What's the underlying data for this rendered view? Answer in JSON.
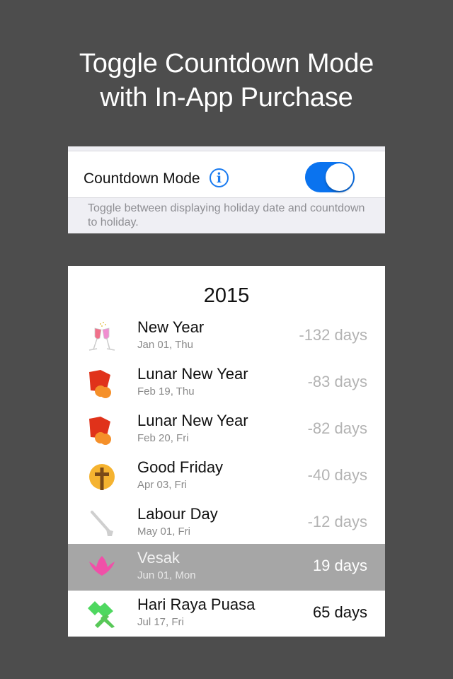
{
  "headline": {
    "line1": "Toggle Countdown Mode",
    "line2": "with In-App Purchase"
  },
  "settings": {
    "countdown_mode_label": "Countdown Mode",
    "info_icon": "info-circle-icon",
    "toggle_on": true,
    "toggle_color": "#0a73ef",
    "footer_text": "Toggle between displaying holiday date and countdown to holiday."
  },
  "holidays": {
    "year": "2015",
    "items": [
      {
        "name": "New Year",
        "date": "Jan 01, Thu",
        "count": "-132 days",
        "icon": "champagne-glasses-icon"
      },
      {
        "name": "Lunar New Year",
        "date": "Feb 19, Thu",
        "count": "-83 days",
        "icon": "red-packet-icon"
      },
      {
        "name": "Lunar New Year",
        "date": "Feb 20, Fri",
        "count": "-82 days",
        "icon": "red-packet-icon"
      },
      {
        "name": "Good Friday",
        "date": "Apr 03, Fri",
        "count": "-40 days",
        "icon": "cross-icon"
      },
      {
        "name": "Labour Day",
        "date": "May 01, Fri",
        "count": "-12 days",
        "icon": "wrench-icon"
      },
      {
        "name": "Vesak",
        "date": "Jun 01, Mon",
        "count": "19 days",
        "icon": "lotus-icon",
        "selected": true
      },
      {
        "name": "Hari Raya Puasa",
        "date": "Jul 17, Fri",
        "count": "65 days",
        "icon": "ketupat-icon"
      }
    ]
  }
}
